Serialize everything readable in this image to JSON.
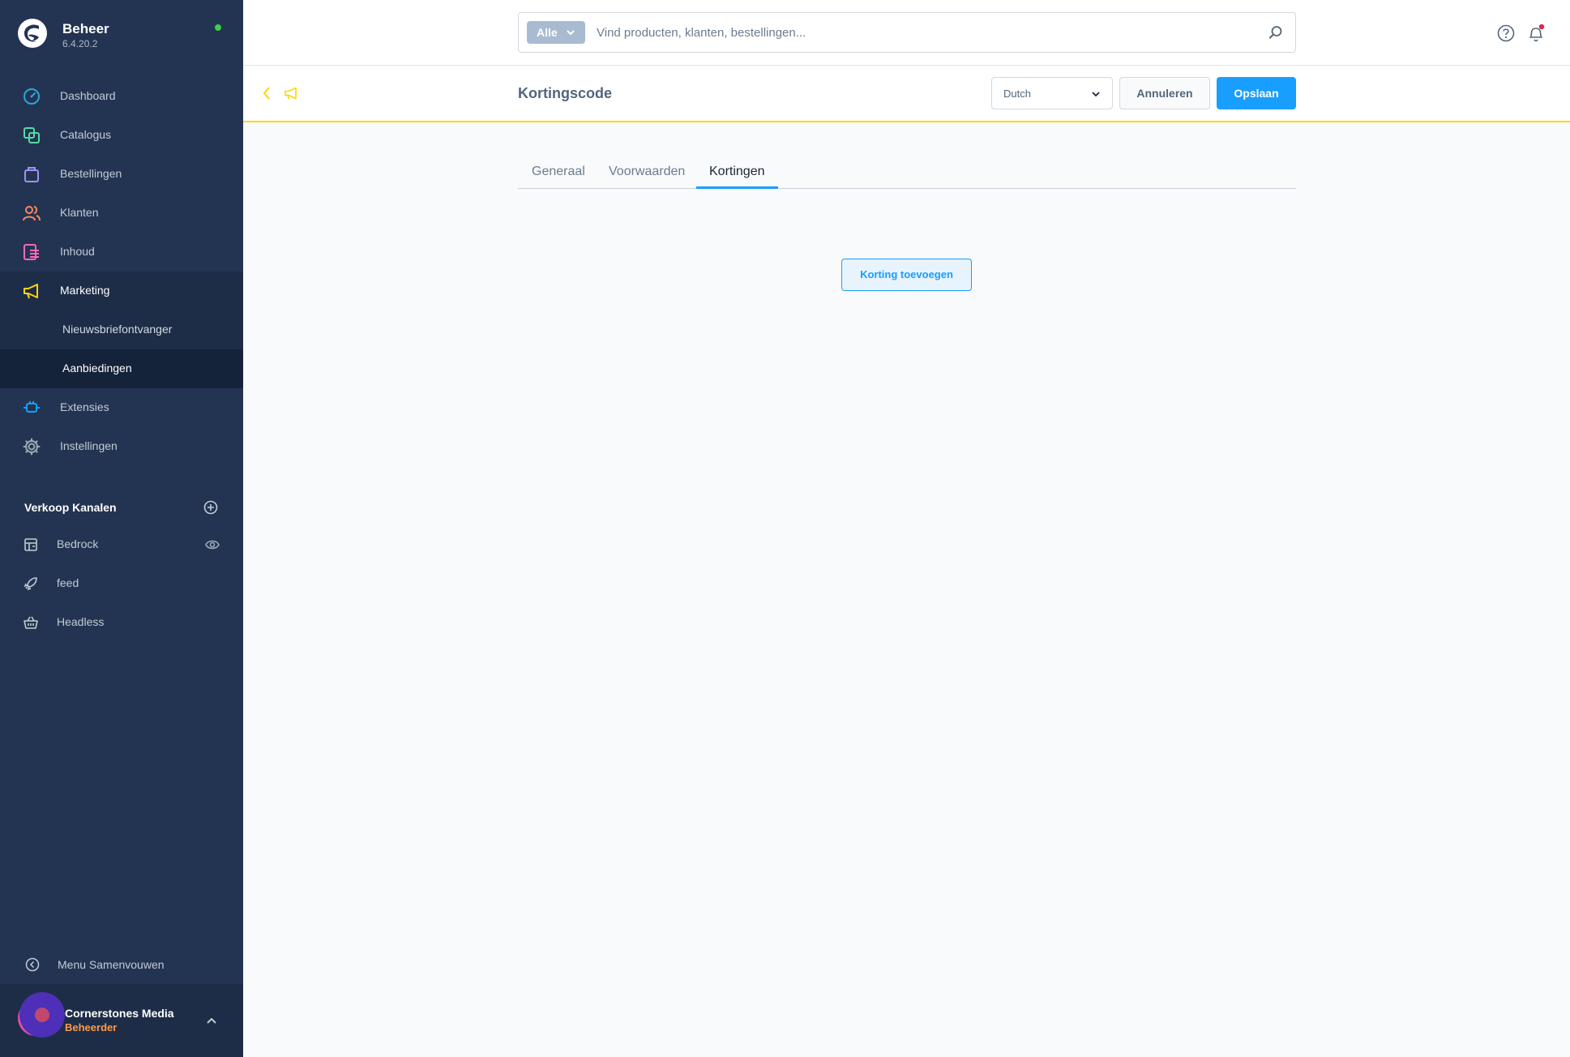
{
  "app": {
    "title": "Beheer",
    "version": "6.4.20.2",
    "status_color": "#37d046"
  },
  "sidebar": {
    "items": [
      {
        "label": "Dashboard",
        "icon": "dashboard-gauge-icon",
        "color": "#2ea7d7"
      },
      {
        "label": "Catalogus",
        "icon": "catalog-copy-icon",
        "color": "#57d9a3"
      },
      {
        "label": "Bestellingen",
        "icon": "orders-bag-icon",
        "color": "#a092f0"
      },
      {
        "label": "Klanten",
        "icon": "customers-users-icon",
        "color": "#f88962"
      },
      {
        "label": "Inhoud",
        "icon": "content-list-icon",
        "color": "#ff68b4"
      },
      {
        "label": "Marketing",
        "icon": "marketing-megaphone-icon",
        "color": "#ffd700"
      },
      {
        "label": "Extensies",
        "icon": "extensions-plug-icon",
        "color": "#189eff"
      },
      {
        "label": "Instellingen",
        "icon": "settings-gear-icon",
        "color": "#9aa8b5"
      }
    ],
    "marketing_children": [
      {
        "label": "Nieuwsbriefontvanger"
      },
      {
        "label": "Aanbiedingen"
      }
    ],
    "channels_title": "Verkoop Kanalen",
    "channels": [
      {
        "label": "Bedrock",
        "icon": "storefront-icon"
      },
      {
        "label": "feed",
        "icon": "rocket-icon"
      },
      {
        "label": "Headless",
        "icon": "basket-icon"
      }
    ],
    "collapse_label": "Menu Samenvouwen",
    "user": {
      "name": "Cornerstones Media",
      "role": "Beheerder",
      "role_color": "#ff9a47"
    }
  },
  "topbar": {
    "search_type": "Alle",
    "search_placeholder": "Vind producten, klanten, bestellingen..."
  },
  "smartbar": {
    "title": "Kortingscode",
    "language": "Dutch",
    "cancel_label": "Annuleren",
    "save_label": "Opslaan",
    "accent_color": "#ffd700",
    "primary_color": "#189eff"
  },
  "tabs": [
    {
      "label": "Generaal",
      "active": false
    },
    {
      "label": "Voorwaarden",
      "active": false
    },
    {
      "label": "Kortingen",
      "active": true
    }
  ],
  "content": {
    "add_discount_label": "Korting toevoegen"
  }
}
